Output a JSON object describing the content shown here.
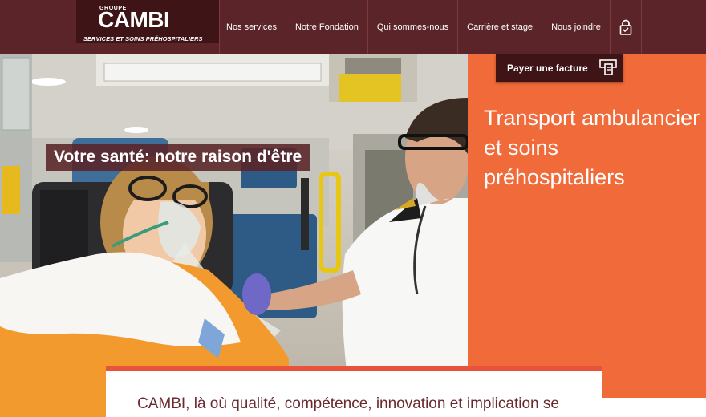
{
  "logo": {
    "groupe": "GROUPE",
    "name": "CAMBI",
    "tagline": "SERVICES ET SOINS PRÉHOSPITALIERS"
  },
  "nav": {
    "items": [
      {
        "label": "Nos services"
      },
      {
        "label": "Notre Fondation"
      },
      {
        "label": "Qui sommes-nous"
      },
      {
        "label": "Carrière et stage"
      },
      {
        "label": "Nous joindre"
      }
    ],
    "lock_icon": "lock-icon"
  },
  "hero": {
    "slogan": "Votre santé: notre raison d'être",
    "title": "Transport ambulancier et soins préhospitaliers",
    "pay_label": "Payer une facture",
    "pay_icon": "bill-payment-icon"
  },
  "content": {
    "intro": "CAMBI, là où qualité, compétence, innovation et implication se"
  },
  "colors": {
    "nav_bg": "#5a2428",
    "logo_bg": "#3f1417",
    "accent_orange": "#f06a3a",
    "card_border": "#e8533a",
    "text_maroon": "#6b2a2e"
  }
}
